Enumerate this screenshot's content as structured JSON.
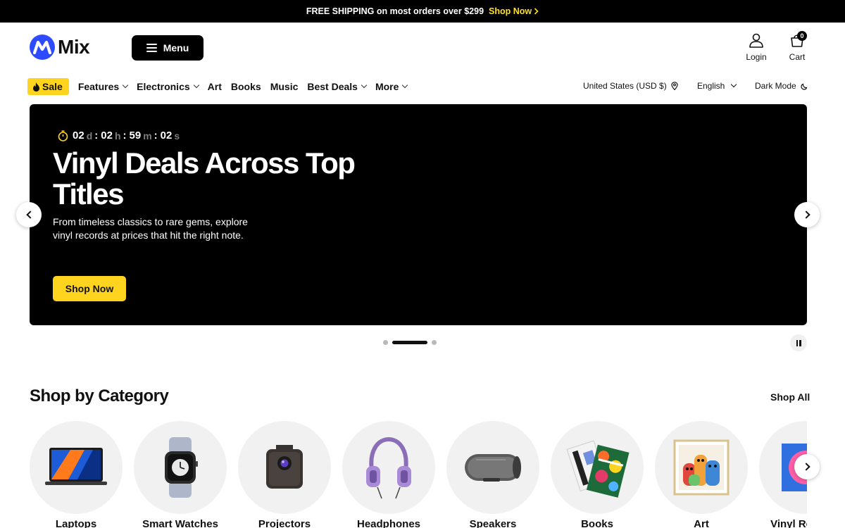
{
  "announcement": {
    "text": "FREE SHIPPING on most orders over $299",
    "link_label": "Shop Now"
  },
  "header": {
    "logo_text": "Mix",
    "menu_label": "Menu",
    "login_label": "Login",
    "cart_label": "Cart",
    "cart_count": "0"
  },
  "nav": {
    "sale_label": "Sale",
    "items": [
      {
        "label": "Features",
        "dropdown": true
      },
      {
        "label": "Electronics",
        "dropdown": true
      },
      {
        "label": "Art",
        "dropdown": false
      },
      {
        "label": "Books",
        "dropdown": false
      },
      {
        "label": "Music",
        "dropdown": false
      },
      {
        "label": "Best Deals",
        "dropdown": true
      },
      {
        "label": "More",
        "dropdown": true
      }
    ],
    "region": "United States (USD $)",
    "language": "English",
    "dark_mode": "Dark Mode"
  },
  "hero": {
    "countdown": {
      "days": "02",
      "days_unit": "d",
      "hours": "02",
      "hours_unit": "h",
      "minutes": "59",
      "minutes_unit": "m",
      "seconds": "02",
      "seconds_unit": "s"
    },
    "title": "Vinyl Deals Across Top Titles",
    "subtitle": "From timeless classics to rare gems, explore vinyl records at prices that hit the right note.",
    "cta": "Shop Now",
    "slide_count": 3,
    "active_slide": 2
  },
  "categories": {
    "title": "Shop by Category",
    "shop_all": "Shop All",
    "items": [
      {
        "name": "Laptops",
        "icon": "laptop-icon"
      },
      {
        "name": "Smart Watches",
        "icon": "smartwatch-icon"
      },
      {
        "name": "Projectors",
        "icon": "projector-icon"
      },
      {
        "name": "Headphones",
        "icon": "headphones-icon"
      },
      {
        "name": "Speakers",
        "icon": "speaker-icon"
      },
      {
        "name": "Books",
        "icon": "book-icon"
      },
      {
        "name": "Art",
        "icon": "art-icon"
      },
      {
        "name": "Vinyl Records",
        "icon": "vinyl-icon"
      }
    ]
  },
  "colors": {
    "accent": "#ffd41f",
    "brand": "#2f4bff",
    "hero_bg": "#000000"
  }
}
